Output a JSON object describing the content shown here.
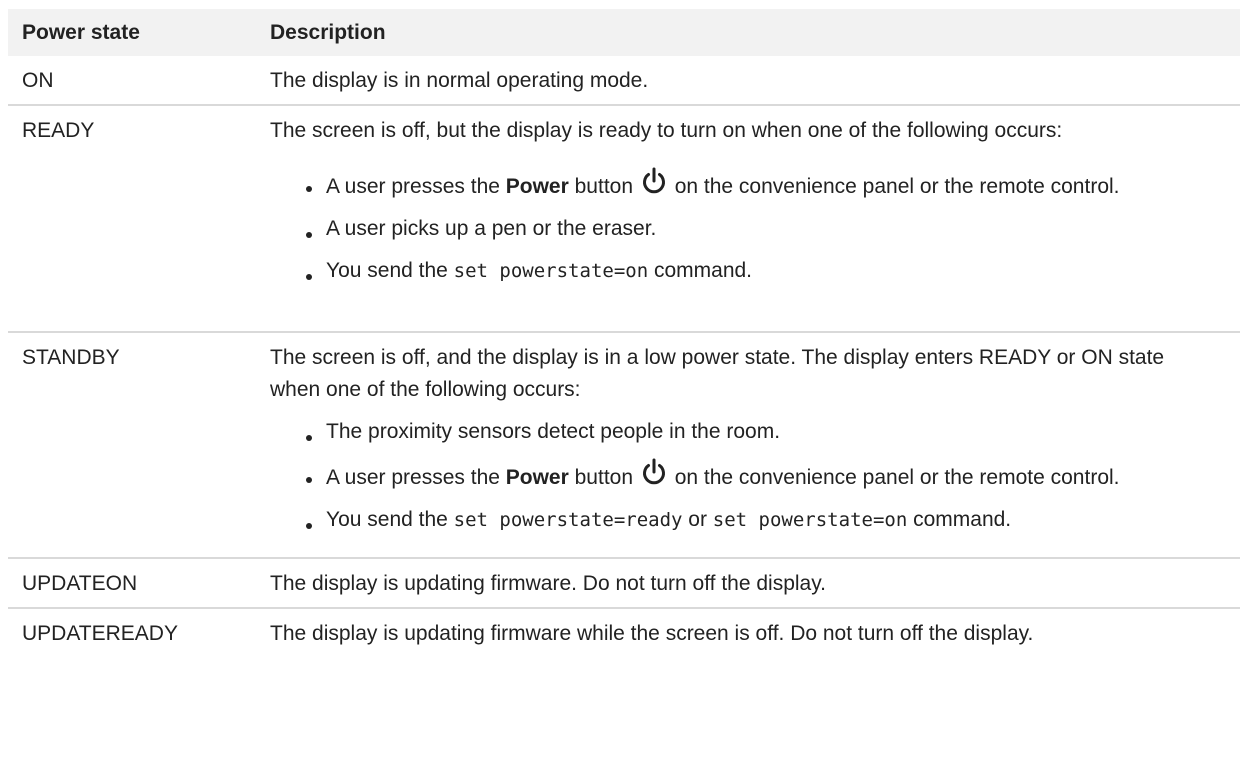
{
  "headers": {
    "state": "Power state",
    "description": "Description"
  },
  "rows": [
    {
      "state": "ON",
      "description": "The display is in normal operating mode."
    },
    {
      "state": "READY",
      "intro": "The screen is off, but the display is ready to turn on when one of the following occurs:",
      "bullets": [
        {
          "pre": "A user presses the ",
          "bold": "Power",
          "post": " button",
          "after_icon": " on the convenience panel or the remote control."
        },
        {
          "text": "A user picks up a pen or the eraser."
        },
        {
          "pre": "You send the ",
          "code": "set powerstate=on",
          "post": " command."
        }
      ]
    },
    {
      "state": "STANDBY",
      "intro": "The screen is off, and the display is in a low power state. The display enters READY or ON state when one of the following occurs:",
      "bullets": [
        {
          "text": "The proximity sensors detect people in the room."
        },
        {
          "pre": "A user presses the ",
          "bold": "Power",
          "post": " button",
          "after_icon": " on the convenience panel or the remote control."
        },
        {
          "pre": "You send the ",
          "code": "set powerstate=ready",
          "mid": " or ",
          "code2": "set powerstate=on",
          "post": " command."
        }
      ]
    },
    {
      "state": "UPDATEON",
      "description": "The display is updating firmware. Do not turn off the display."
    },
    {
      "state": "UPDATEREADY",
      "description": "The display is updating firmware while the screen is off. Do not turn off the display."
    }
  ],
  "icons": {
    "power": "power-icon"
  },
  "colors": {
    "header_bg": "#f2f2f2",
    "divider": "#d9d9d9",
    "text": "#222222"
  }
}
